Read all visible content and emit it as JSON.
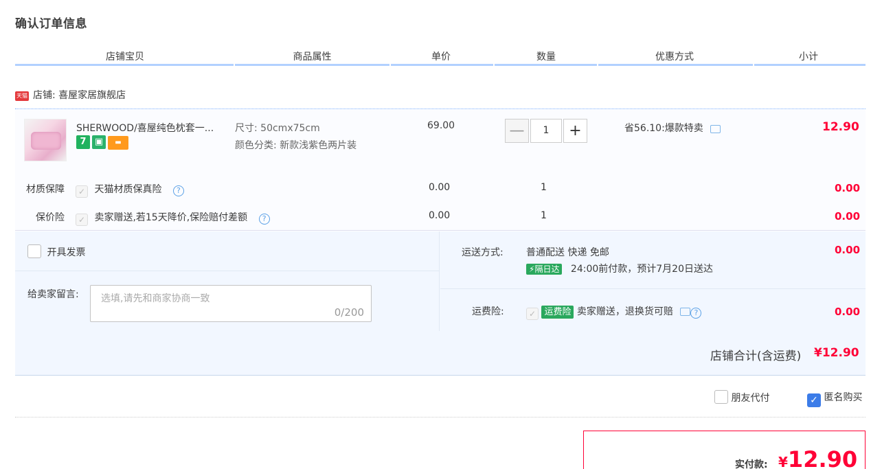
{
  "page_title": "确认订单信息",
  "columns": [
    "店铺宝贝",
    "商品属性",
    "单价",
    "数量",
    "优惠方式",
    "小计"
  ],
  "shop": {
    "badge": "天猫",
    "label": "店铺: 喜屋家居旗舰店"
  },
  "item": {
    "name": "SHERWOOD/喜屋纯色枕套一...",
    "attr_size": "尺寸: 50cmx75cm",
    "attr_color": "颜色分类: 新款浅紫色两片装",
    "price": "69.00",
    "qty": "1",
    "minus": "—",
    "plus": "+",
    "discount": "省56.10:爆款特卖",
    "subtotal": "12.90",
    "badge_7": "7"
  },
  "service1": {
    "label": "材质保障",
    "check": "✓",
    "desc": "天猫材质保真险",
    "help": "?",
    "price": "0.00",
    "qty": "1",
    "subtotal": "0.00"
  },
  "service2": {
    "label": "保价险",
    "check": "✓",
    "desc": "卖家赠送,若15天降价,保险赔付差额",
    "help": "?",
    "price": "0.00",
    "qty": "1",
    "subtotal": "0.00"
  },
  "invoice_label": "开具发票",
  "message": {
    "label": "给卖家留言:",
    "placeholder": "选填,请先和商家协商一致",
    "counter": "0/200"
  },
  "shipping": {
    "label": "运送方式:",
    "method": "普通配送 快递 免邮",
    "badge": "隔日达",
    "note": "24:00前付款，预计7月20日送达",
    "fee": "0.00"
  },
  "shipping_insurance": {
    "label": "运费险:",
    "check": "✓",
    "badge": "运费险",
    "desc": "卖家赠送，退换货可赔",
    "help": "?",
    "fee": "0.00"
  },
  "shop_total": {
    "label": "店铺合计(含运费)",
    "value": "¥12.90"
  },
  "options": {
    "friend_pay": "朋友代付",
    "anonymous": "匿名购买",
    "anonymous_check": "✓"
  },
  "pay": {
    "label": "实付款:",
    "currency": "¥",
    "amount": "12.90"
  }
}
